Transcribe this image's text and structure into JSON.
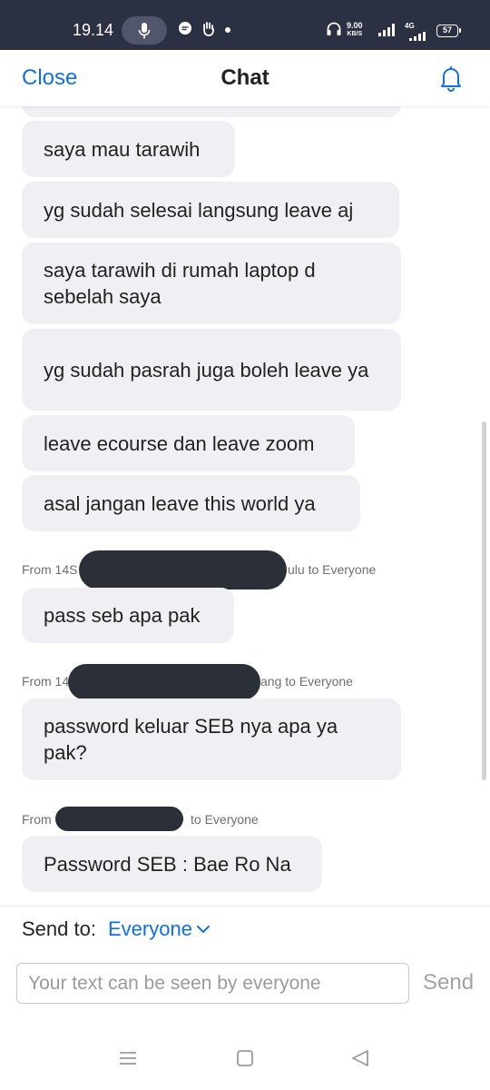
{
  "status_bar": {
    "time": "19.14",
    "net_speed_value": "9.00",
    "net_speed_unit": "KB/S",
    "network": "4G",
    "battery": "57",
    "icons": [
      "mic-icon",
      "chat-bubble-icon",
      "hand-icon",
      "dot-icon",
      "headphones-icon",
      "signal-icon",
      "battery-icon"
    ]
  },
  "header": {
    "close_label": "Close",
    "title": "Chat",
    "bell_icon": "bell-icon"
  },
  "messages": [
    {
      "text": "saya mau tarawih"
    },
    {
      "text": "yg sudah selesai langsung leave aj"
    },
    {
      "text": "saya tarawih di rumah laptop d sebelah saya"
    },
    {
      "text": "yg sudah pasrah juga boleh leave ya"
    },
    {
      "text": "leave ecourse dan leave zoom"
    },
    {
      "text": "asal jangan leave this world ya"
    }
  ],
  "groups": [
    {
      "from_prefix": "From 14S",
      "from_suffix": "ulu to Everyone",
      "message": "pass seb apa pak"
    },
    {
      "from_prefix": "From 14",
      "from_suffix": "ang to Everyone",
      "message": "password keluar SEB nya apa ya pak?"
    },
    {
      "from_prefix": "From",
      "from_suffix": "to Everyone",
      "message": "Password SEB : Bae Ro Na"
    }
  ],
  "composer": {
    "send_to_label": "Send to:",
    "send_to_value": "Everyone",
    "input_placeholder": "Your text can be seen by everyone",
    "send_label": "Send"
  },
  "colors": {
    "accent": "#0e71eb",
    "bubble": "#f0f0f4",
    "status_bar": "#2b3042"
  }
}
